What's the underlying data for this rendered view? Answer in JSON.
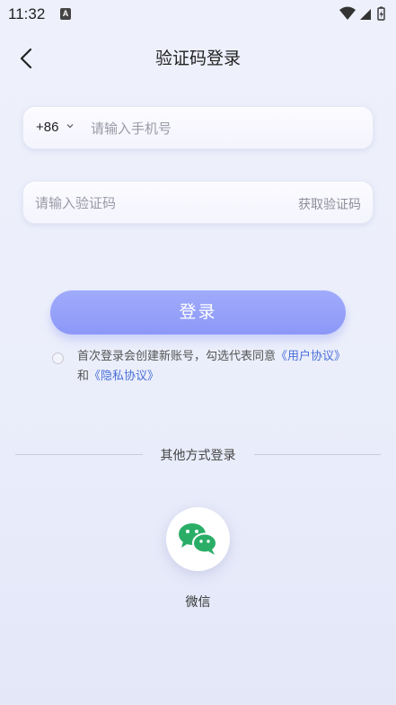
{
  "status_bar": {
    "time": "11:32",
    "notification_glyph": "A",
    "icons": [
      "wifi-icon",
      "signal-icon",
      "battery-icon"
    ]
  },
  "header": {
    "title": "验证码登录",
    "back_icon": "chevron-left-icon"
  },
  "phone_field": {
    "country_code": "+86",
    "chevron_icon": "chevron-down-icon",
    "placeholder": "请输入手机号",
    "value": ""
  },
  "code_field": {
    "placeholder": "请输入验证码",
    "value": "",
    "get_code_label": "获取验证码"
  },
  "login_button": {
    "label": "登录"
  },
  "agreement": {
    "checked": false,
    "text_prefix": "首次登录会创建新账号，勾选代表同意",
    "user_agreement_link": "《用户协议》",
    "conjunction": "和",
    "privacy_link": "《隐私协议》"
  },
  "other_login": {
    "divider_text": "其他方式登录",
    "wechat_label": "微信",
    "wechat_icon": "wechat-icon"
  },
  "colors": {
    "accent": "#8c98f7",
    "link": "#4a6fd8",
    "wechat_green": "#2aae67",
    "background": "#eceffb"
  }
}
